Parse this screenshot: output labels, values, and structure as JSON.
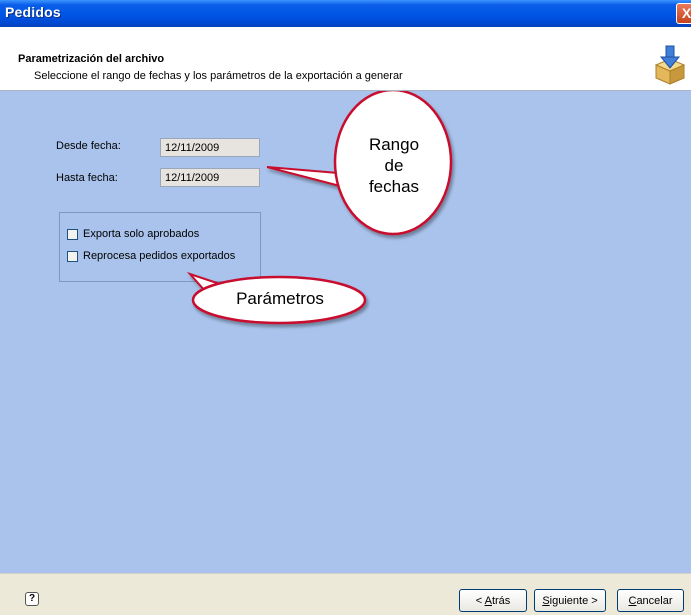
{
  "window": {
    "title": "Pedidos",
    "close_label": "X"
  },
  "header": {
    "title": "Parametrización del archivo",
    "subtitle": "Seleccione el rango de fechas y los parámetros de la exportación a generar",
    "icon": "download-box-icon"
  },
  "form": {
    "desde_label": "Desde fecha:",
    "desde_value": "12/11/2009",
    "hasta_label": "Hasta fecha:",
    "hasta_value": "12/11/2009",
    "options": [
      {
        "label": "Exporta solo aprobados",
        "checked": false
      },
      {
        "label": "Reprocesa pedidos exportados",
        "checked": false
      }
    ]
  },
  "callouts": {
    "rango": [
      "Rango",
      "de",
      "fechas"
    ],
    "parametros": "Parámetros"
  },
  "footer": {
    "help_label": "?",
    "back": {
      "prefix": "< ",
      "key": "A",
      "rest": "trás"
    },
    "next": {
      "prefix": "",
      "key": "S",
      "rest": "iguiente >"
    },
    "cancel": {
      "prefix": "",
      "key": "C",
      "rest": "ancelar"
    }
  },
  "colors": {
    "titlebar": "#0055e5",
    "content_bg": "#a9c3ec",
    "callout_border": "#c8102e",
    "footer_bg": "#ece9d8"
  }
}
